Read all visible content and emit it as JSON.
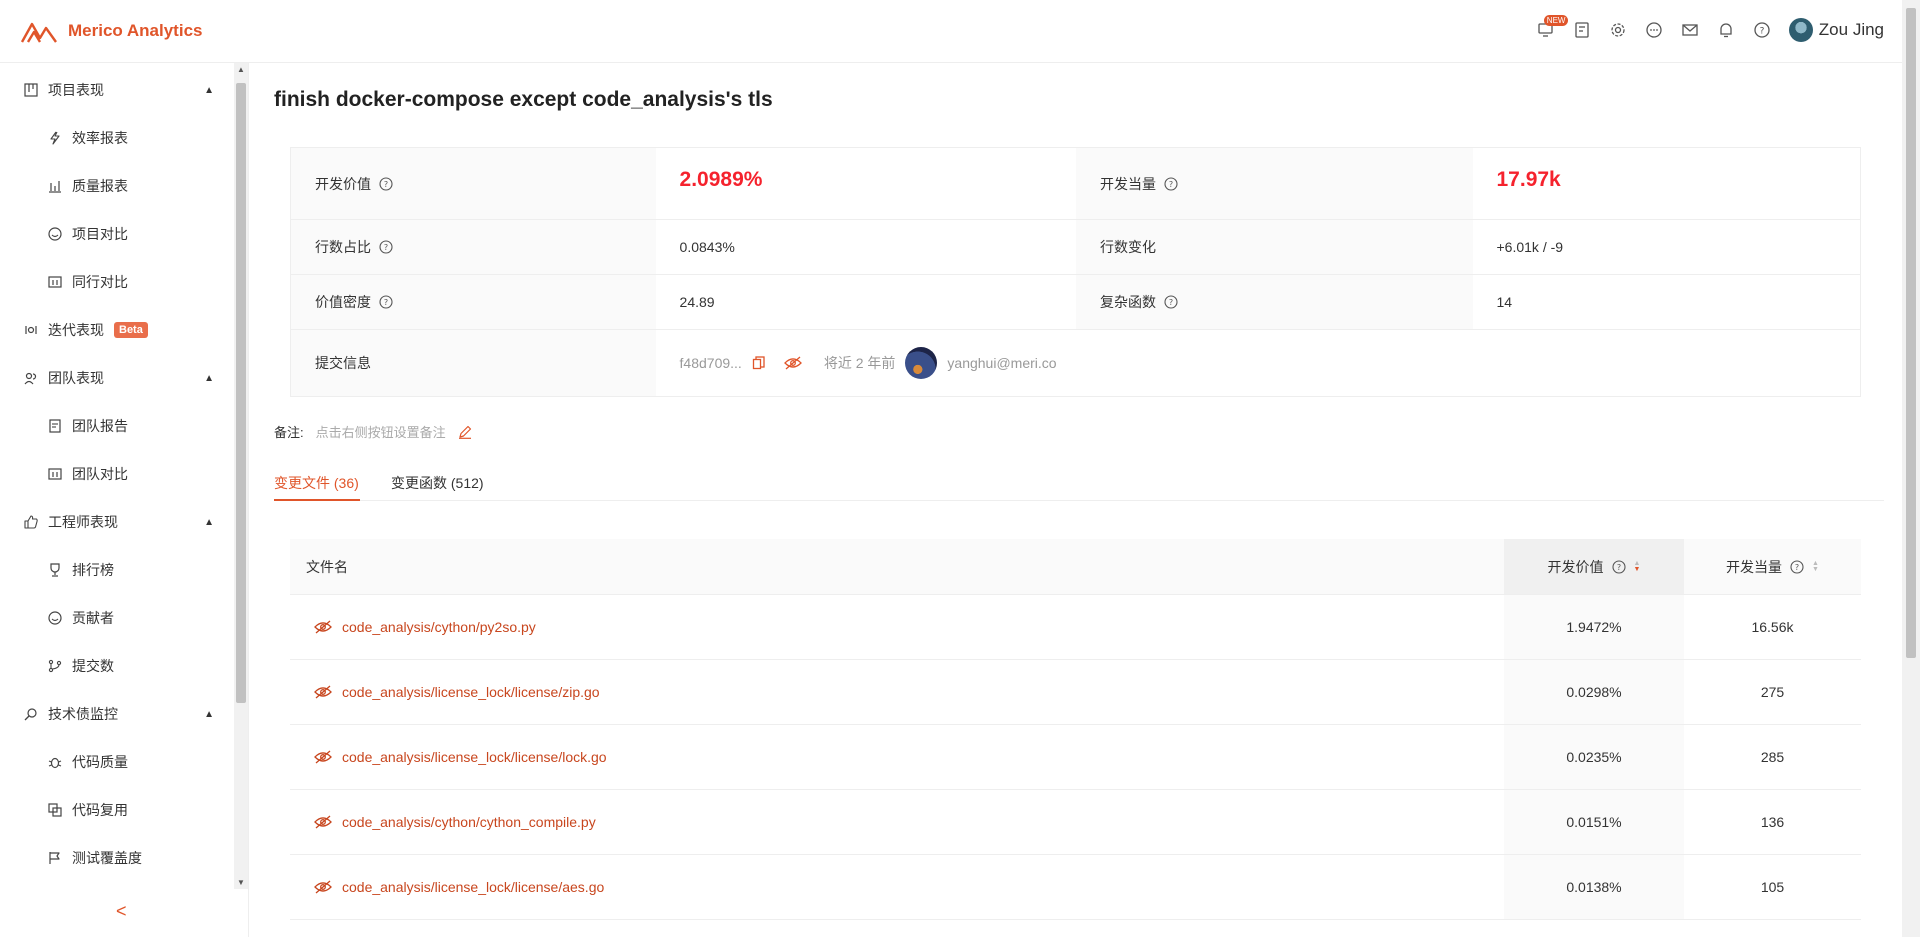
{
  "header": {
    "brand_name": "Merico Analytics",
    "new_badge": "NEW",
    "user_name": "Zou Jing"
  },
  "sidebar": {
    "groups": [
      {
        "label": "项目表现",
        "items": [
          "效率报表",
          "质量报表",
          "项目对比",
          "同行对比"
        ]
      },
      {
        "label": "迭代表现",
        "badge": "Beta"
      },
      {
        "label": "团队表现",
        "items": [
          "团队报告",
          "团队对比"
        ]
      },
      {
        "label": "工程师表现",
        "items": [
          "排行榜",
          "贡献者",
          "提交数"
        ]
      },
      {
        "label": "技术债监控",
        "items": [
          "代码质量",
          "代码复用",
          "测试覆盖度"
        ]
      }
    ],
    "collapse_glyph": "<"
  },
  "main": {
    "title": "finish docker-compose except code_analysis's tls",
    "info": {
      "dev_value_label": "开发价值",
      "dev_value": "2.0989%",
      "dev_equiv_label": "开发当量",
      "dev_equiv": "17.97k",
      "line_share_label": "行数占比",
      "line_share": "0.0843%",
      "line_change_label": "行数变化",
      "line_change": "+6.01k / -9",
      "value_density_label": "价值密度",
      "value_density": "24.89",
      "complex_func_label": "复杂函数",
      "complex_func": "14",
      "commit_label": "提交信息",
      "commit_hash": "f48d709...",
      "commit_time": "将近 2 年前",
      "commit_author": "yanghui@meri.co"
    },
    "note_label": "备注:",
    "note_placeholder": "点击右侧按钮设置备注",
    "tabs": [
      "变更文件 (36)",
      "变更函数 (512)"
    ],
    "file_table": {
      "headers": {
        "name": "文件名",
        "value": "开发价值",
        "equiv": "开发当量"
      },
      "rows": [
        {
          "name": "code_analysis/cython/py2so.py",
          "value": "1.9472%",
          "equiv": "16.56k"
        },
        {
          "name": "code_analysis/license_lock/license/zip.go",
          "value": "0.0298%",
          "equiv": "275"
        },
        {
          "name": "code_analysis/license_lock/license/lock.go",
          "value": "0.0235%",
          "equiv": "285"
        },
        {
          "name": "code_analysis/cython/cython_compile.py",
          "value": "0.0151%",
          "equiv": "136"
        },
        {
          "name": "code_analysis/license_lock/license/aes.go",
          "value": "0.0138%",
          "equiv": "105"
        }
      ]
    }
  },
  "colors": {
    "accent": "#e0552a",
    "highlight": "#f5222d"
  }
}
